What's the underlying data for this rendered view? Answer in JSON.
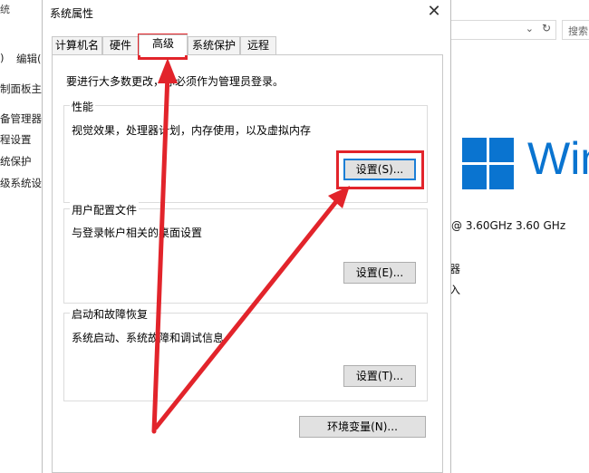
{
  "background_window": {
    "top_fragment": "统",
    "left_nav": [
      "编辑(",
      "制面板主",
      "备管理器",
      "程设置",
      "统保护",
      "级系统设"
    ],
    "left_paren": ")",
    "search_fragment": "搜索",
    "windows_text": "Win",
    "cpu_text": "@ 3.60GHz   3.60 GHz",
    "fragment_1": "器",
    "fragment_2": "入"
  },
  "dialog": {
    "title": "系统属性",
    "close_glyph": "✕",
    "tabs": [
      "计算机名",
      "硬件",
      "高级",
      "系统保护",
      "远程"
    ],
    "active_tab": "高级",
    "admin_note": "要进行大多数更改，你必须作为管理员登录。",
    "performance": {
      "title": "性能",
      "description": "视觉效果，处理器计划，内存使用，以及虚拟内存",
      "button": "设置(S)..."
    },
    "user_profiles": {
      "title": "用户配置文件",
      "description": "与登录帐户相关的桌面设置",
      "button": "设置(E)..."
    },
    "startup_recovery": {
      "title": "启动和故障恢复",
      "description": "系统启动、系统故障和调试信息",
      "button": "设置(T)..."
    },
    "env_button": "环境变量(N)..."
  },
  "colors": {
    "annotation_red": "#e2242b",
    "windows_blue": "#0a74d0",
    "focus_blue": "#1c7fd6"
  }
}
